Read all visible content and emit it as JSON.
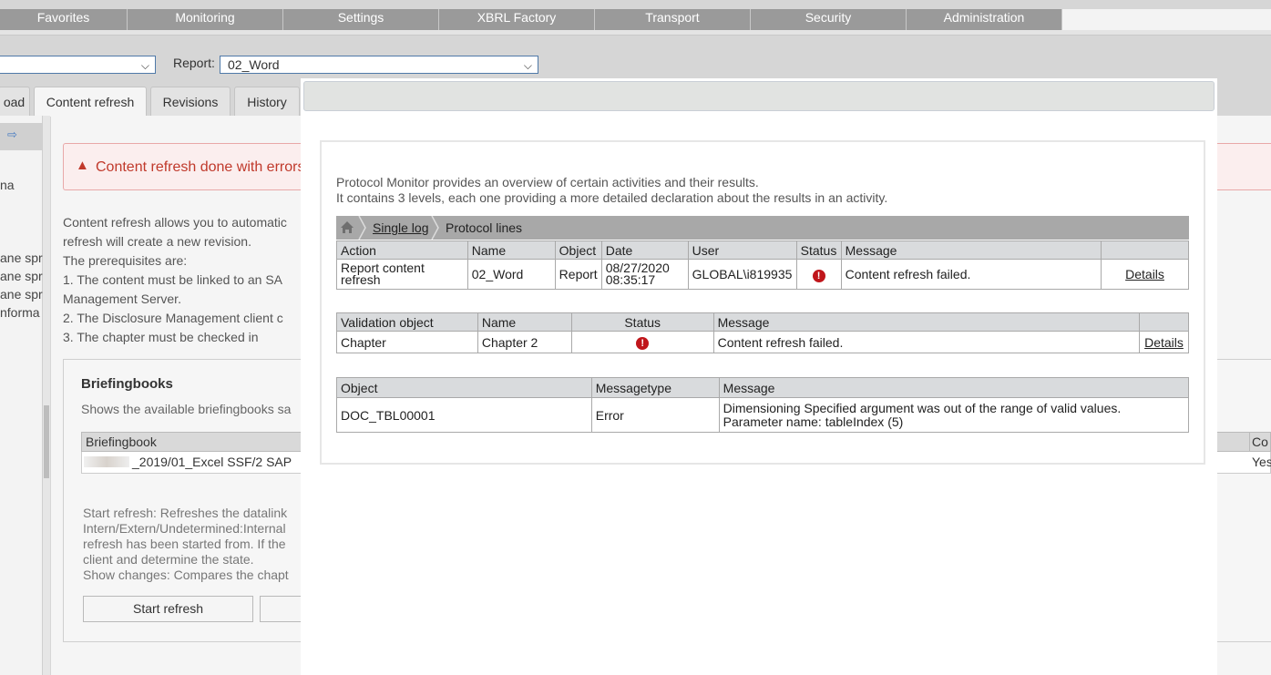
{
  "topnav": {
    "tabs": [
      "Favorites",
      "Monitoring",
      "Settings",
      "XBRL Factory",
      "Transport",
      "Security",
      "Administration"
    ]
  },
  "toolbar": {
    "report_label": "Report:",
    "report_value": "02_Word",
    "left_select_value": ""
  },
  "subtabs": [
    "oad",
    "Content refresh",
    "Revisions",
    "History"
  ],
  "left_panel": {
    "items": [
      "na",
      "ane spr",
      "ane spr",
      "ane spr",
      "nforma"
    ]
  },
  "main": {
    "error_message": "Content refresh done with errors",
    "description_lines": [
      "Content refresh allows you to automatic",
      "refresh will create a new revision.",
      "The prerequisites are:",
      " 1. The content must be linked to an SA",
      "Management Server.",
      " 2. The Disclosure Management client c",
      " 3. The chapter must be checked in"
    ],
    "briefingbooks": {
      "title": "Briefingbooks",
      "subtitle": "Shows the available briefingbooks sa",
      "col_header": "Briefingbook",
      "col_header_right": "Co",
      "row_value": "_2019/01_Excel SSF/2 SAP",
      "row_value_right": "Yes",
      "help_lines": [
        "Start refresh: Refreshes the datalink",
        "Intern/Extern/Undetermined:Internal",
        "refresh has been started from. If the",
        "client and determine the state.",
        "Show changes: Compares the chapt"
      ],
      "start_refresh_label": "Start refresh"
    }
  },
  "modal": {
    "intro_line1": "Protocol Monitor provides an overview of certain activities and their results.",
    "intro_line2": "It contains 3 levels, each one providing a more detailed declaration about the results in an activity.",
    "breadcrumb": {
      "single_log": "Single log",
      "protocol_lines": "Protocol lines"
    },
    "activity_table": {
      "headers": [
        "Action",
        "Name",
        "Object",
        "Date",
        "User",
        "Status",
        "Message",
        ""
      ],
      "row": {
        "action_line1": "Report content",
        "action_line2": "refresh",
        "name": "02_Word",
        "object": "Report",
        "date_line1": "08/27/2020",
        "date_line2": "08:35:17",
        "user": "GLOBAL\\i819935",
        "status_icon": "error-icon",
        "message": "Content refresh failed.",
        "details": "Details"
      }
    },
    "validation_table": {
      "headers": [
        "Validation object",
        "Name",
        "Status",
        "Message",
        ""
      ],
      "row": {
        "validation_object": "Chapter",
        "name": "Chapter 2",
        "status_icon": "error-icon",
        "message": "Content refresh failed.",
        "details": "Details"
      }
    },
    "message_table": {
      "headers": [
        "Object",
        "Messagetype",
        "Message"
      ],
      "row": {
        "object": "DOC_TBL00001",
        "messagetype": "Error",
        "message_line1": "Dimensioning Specified argument was out of the range of valid values.",
        "message_line2": "Parameter name: tableIndex (5)"
      }
    }
  },
  "colors": {
    "error_red": "#c0161b",
    "nav_grey": "#9a9a9a",
    "breadcrumb_grey": "#a8a8a8",
    "select_border": "#4f79a8"
  }
}
